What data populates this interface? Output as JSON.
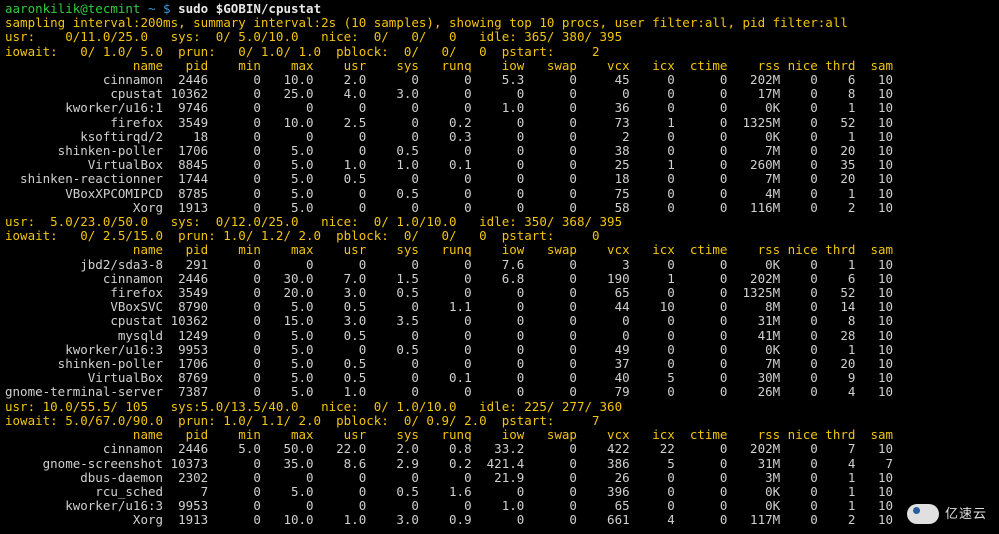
{
  "prompt": {
    "user": "aaronkilik@tecmint",
    "sep": " ~ $ ",
    "cmd": "sudo $GOBIN/cpustat"
  },
  "summary": "sampling interval:200ms, summary interval:2s (10 samples), showing top 10 procs, user filter:all, pid filter:all",
  "columns": [
    "name",
    "pid",
    "min",
    "max",
    "usr",
    "sys",
    "runq",
    "iow",
    "swap",
    "vcx",
    "icx",
    "ctime",
    "rss",
    "nice",
    "thrd",
    "sam"
  ],
  "blocks": [
    {
      "metrics": {
        "usr": "0/11.0/25.0",
        "sys": "0/ 5.0/10.0",
        "nice": "0/   0/   0",
        "idle": "365/ 380/ 395",
        "iowait": "0/ 1.0/ 5.0",
        "prun": "0/ 1.0/ 1.0",
        "pblock": "0/   0/   0",
        "pstart": "2"
      },
      "rows": [
        {
          "name": "cinnamon",
          "pid": "2446",
          "min": "0",
          "max": "10.0",
          "usr": "2.0",
          "sys": "0",
          "runq": "0",
          "iow": "5.3",
          "swap": "0",
          "vcx": "45",
          "icx": "0",
          "ctime": "0",
          "rss": "202M",
          "nice": "0",
          "thrd": "6",
          "sam": "10"
        },
        {
          "name": "cpustat",
          "pid": "10362",
          "min": "0",
          "max": "25.0",
          "usr": "4.0",
          "sys": "3.0",
          "runq": "0",
          "iow": "0",
          "swap": "0",
          "vcx": "0",
          "icx": "0",
          "ctime": "0",
          "rss": "17M",
          "nice": "0",
          "thrd": "8",
          "sam": "10"
        },
        {
          "name": "kworker/u16:1",
          "pid": "9746",
          "min": "0",
          "max": "0",
          "usr": "0",
          "sys": "0",
          "runq": "0",
          "iow": "1.0",
          "swap": "0",
          "vcx": "36",
          "icx": "0",
          "ctime": "0",
          "rss": "0K",
          "nice": "0",
          "thrd": "1",
          "sam": "10"
        },
        {
          "name": "firefox",
          "pid": "3549",
          "min": "0",
          "max": "10.0",
          "usr": "2.5",
          "sys": "0",
          "runq": "0.2",
          "iow": "0",
          "swap": "0",
          "vcx": "73",
          "icx": "1",
          "ctime": "0",
          "rss": "1325M",
          "nice": "0",
          "thrd": "52",
          "sam": "10"
        },
        {
          "name": "ksoftirqd/2",
          "pid": "18",
          "min": "0",
          "max": "0",
          "usr": "0",
          "sys": "0",
          "runq": "0.3",
          "iow": "0",
          "swap": "0",
          "vcx": "2",
          "icx": "0",
          "ctime": "0",
          "rss": "0K",
          "nice": "0",
          "thrd": "1",
          "sam": "10"
        },
        {
          "name": "shinken-poller",
          "pid": "1706",
          "min": "0",
          "max": "5.0",
          "usr": "0",
          "sys": "0.5",
          "runq": "0",
          "iow": "0",
          "swap": "0",
          "vcx": "38",
          "icx": "0",
          "ctime": "0",
          "rss": "7M",
          "nice": "0",
          "thrd": "20",
          "sam": "10"
        },
        {
          "name": "VirtualBox",
          "pid": "8845",
          "min": "0",
          "max": "5.0",
          "usr": "1.0",
          "sys": "1.0",
          "runq": "0.1",
          "iow": "0",
          "swap": "0",
          "vcx": "25",
          "icx": "1",
          "ctime": "0",
          "rss": "260M",
          "nice": "0",
          "thrd": "35",
          "sam": "10"
        },
        {
          "name": "shinken-reactionner",
          "pid": "1744",
          "min": "0",
          "max": "5.0",
          "usr": "0.5",
          "sys": "0",
          "runq": "0",
          "iow": "0",
          "swap": "0",
          "vcx": "18",
          "icx": "0",
          "ctime": "0",
          "rss": "7M",
          "nice": "0",
          "thrd": "20",
          "sam": "10"
        },
        {
          "name": "VBoxXPCOMIPCD",
          "pid": "8785",
          "min": "0",
          "max": "5.0",
          "usr": "0",
          "sys": "0.5",
          "runq": "0",
          "iow": "0",
          "swap": "0",
          "vcx": "75",
          "icx": "0",
          "ctime": "0",
          "rss": "4M",
          "nice": "0",
          "thrd": "1",
          "sam": "10"
        },
        {
          "name": "Xorg",
          "pid": "1913",
          "min": "0",
          "max": "5.0",
          "usr": "0",
          "sys": "0",
          "runq": "0",
          "iow": "0",
          "swap": "0",
          "vcx": "58",
          "icx": "0",
          "ctime": "0",
          "rss": "116M",
          "nice": "0",
          "thrd": "2",
          "sam": "10"
        }
      ]
    },
    {
      "metrics": {
        "usr": "5.0/23.0/50.0",
        "sys": "0/12.0/25.0",
        "nice": "0/ 1.0/10.0",
        "idle": "350/ 368/ 395",
        "iowait": "0/ 2.5/15.0",
        "prun": "1.0/ 1.2/ 2.0",
        "pblock": "0/   0/   0",
        "pstart": "0"
      },
      "rows": [
        {
          "name": "jbd2/sda3-8",
          "pid": "291",
          "min": "0",
          "max": "0",
          "usr": "0",
          "sys": "0",
          "runq": "0",
          "iow": "7.6",
          "swap": "0",
          "vcx": "3",
          "icx": "0",
          "ctime": "0",
          "rss": "0K",
          "nice": "0",
          "thrd": "1",
          "sam": "10"
        },
        {
          "name": "cinnamon",
          "pid": "2446",
          "min": "0",
          "max": "30.0",
          "usr": "7.0",
          "sys": "1.5",
          "runq": "0",
          "iow": "6.8",
          "swap": "0",
          "vcx": "190",
          "icx": "1",
          "ctime": "0",
          "rss": "202M",
          "nice": "0",
          "thrd": "6",
          "sam": "10"
        },
        {
          "name": "firefox",
          "pid": "3549",
          "min": "0",
          "max": "20.0",
          "usr": "3.0",
          "sys": "0.5",
          "runq": "0",
          "iow": "0",
          "swap": "0",
          "vcx": "65",
          "icx": "0",
          "ctime": "0",
          "rss": "1325M",
          "nice": "0",
          "thrd": "52",
          "sam": "10"
        },
        {
          "name": "VBoxSVC",
          "pid": "8790",
          "min": "0",
          "max": "5.0",
          "usr": "0.5",
          "sys": "0",
          "runq": "1.1",
          "iow": "0",
          "swap": "0",
          "vcx": "44",
          "icx": "10",
          "ctime": "0",
          "rss": "8M",
          "nice": "0",
          "thrd": "14",
          "sam": "10"
        },
        {
          "name": "cpustat",
          "pid": "10362",
          "min": "0",
          "max": "15.0",
          "usr": "3.0",
          "sys": "3.5",
          "runq": "0",
          "iow": "0",
          "swap": "0",
          "vcx": "0",
          "icx": "0",
          "ctime": "0",
          "rss": "31M",
          "nice": "0",
          "thrd": "8",
          "sam": "10"
        },
        {
          "name": "mysqld",
          "pid": "1249",
          "min": "0",
          "max": "5.0",
          "usr": "0.5",
          "sys": "0",
          "runq": "0",
          "iow": "0",
          "swap": "0",
          "vcx": "0",
          "icx": "0",
          "ctime": "0",
          "rss": "41M",
          "nice": "0",
          "thrd": "28",
          "sam": "10"
        },
        {
          "name": "kworker/u16:3",
          "pid": "9953",
          "min": "0",
          "max": "5.0",
          "usr": "0",
          "sys": "0.5",
          "runq": "0",
          "iow": "0",
          "swap": "0",
          "vcx": "49",
          "icx": "0",
          "ctime": "0",
          "rss": "0K",
          "nice": "0",
          "thrd": "1",
          "sam": "10"
        },
        {
          "name": "shinken-poller",
          "pid": "1706",
          "min": "0",
          "max": "5.0",
          "usr": "0.5",
          "sys": "0",
          "runq": "0",
          "iow": "0",
          "swap": "0",
          "vcx": "37",
          "icx": "0",
          "ctime": "0",
          "rss": "7M",
          "nice": "0",
          "thrd": "20",
          "sam": "10"
        },
        {
          "name": "VirtualBox",
          "pid": "8769",
          "min": "0",
          "max": "5.0",
          "usr": "0.5",
          "sys": "0",
          "runq": "0.1",
          "iow": "0",
          "swap": "0",
          "vcx": "40",
          "icx": "5",
          "ctime": "0",
          "rss": "30M",
          "nice": "0",
          "thrd": "9",
          "sam": "10"
        },
        {
          "name": "gnome-terminal-server",
          "pid": "7387",
          "min": "0",
          "max": "5.0",
          "usr": "1.0",
          "sys": "0",
          "runq": "0",
          "iow": "0",
          "swap": "0",
          "vcx": "79",
          "icx": "0",
          "ctime": "0",
          "rss": "26M",
          "nice": "0",
          "thrd": "4",
          "sam": "10"
        }
      ]
    },
    {
      "metrics": {
        "usr": "10.0/55.5/ 105",
        "sys": "5.0/13.5/40.0",
        "nice": "0/ 1.0/10.0",
        "idle": "225/ 277/ 360",
        "iowait": "5.0/67.0/90.0",
        "prun": "1.0/ 1.1/ 2.0",
        "pblock": "0/ 0.9/ 2.0",
        "pstart": "7"
      },
      "rows": [
        {
          "name": "cinnamon",
          "pid": "2446",
          "min": "5.0",
          "max": "50.0",
          "usr": "22.0",
          "sys": "2.0",
          "runq": "0.8",
          "iow": "33.2",
          "swap": "0",
          "vcx": "422",
          "icx": "22",
          "ctime": "0",
          "rss": "202M",
          "nice": "0",
          "thrd": "7",
          "sam": "10"
        },
        {
          "name": "gnome-screenshot",
          "pid": "10373",
          "min": "0",
          "max": "35.0",
          "usr": "8.6",
          "sys": "2.9",
          "runq": "0.2",
          "iow": "421.4",
          "swap": "0",
          "vcx": "386",
          "icx": "5",
          "ctime": "0",
          "rss": "31M",
          "nice": "0",
          "thrd": "4",
          "sam": "7"
        },
        {
          "name": "dbus-daemon",
          "pid": "2302",
          "min": "0",
          "max": "0",
          "usr": "0",
          "sys": "0",
          "runq": "0",
          "iow": "21.9",
          "swap": "0",
          "vcx": "26",
          "icx": "0",
          "ctime": "0",
          "rss": "3M",
          "nice": "0",
          "thrd": "1",
          "sam": "10"
        },
        {
          "name": "rcu_sched",
          "pid": "7",
          "min": "0",
          "max": "5.0",
          "usr": "0",
          "sys": "0.5",
          "runq": "1.6",
          "iow": "0",
          "swap": "0",
          "vcx": "396",
          "icx": "0",
          "ctime": "0",
          "rss": "0K",
          "nice": "0",
          "thrd": "1",
          "sam": "10"
        },
        {
          "name": "kworker/u16:3",
          "pid": "9953",
          "min": "0",
          "max": "0",
          "usr": "0",
          "sys": "0",
          "runq": "0",
          "iow": "1.0",
          "swap": "0",
          "vcx": "65",
          "icx": "0",
          "ctime": "0",
          "rss": "0K",
          "nice": "0",
          "thrd": "1",
          "sam": "10"
        },
        {
          "name": "Xorg",
          "pid": "1913",
          "min": "0",
          "max": "10.0",
          "usr": "1.0",
          "sys": "3.0",
          "runq": "0.9",
          "iow": "0",
          "swap": "0",
          "vcx": "661",
          "icx": "4",
          "ctime": "0",
          "rss": "117M",
          "nice": "0",
          "thrd": "2",
          "sam": "10"
        }
      ]
    }
  ],
  "watermark": "亿速云"
}
